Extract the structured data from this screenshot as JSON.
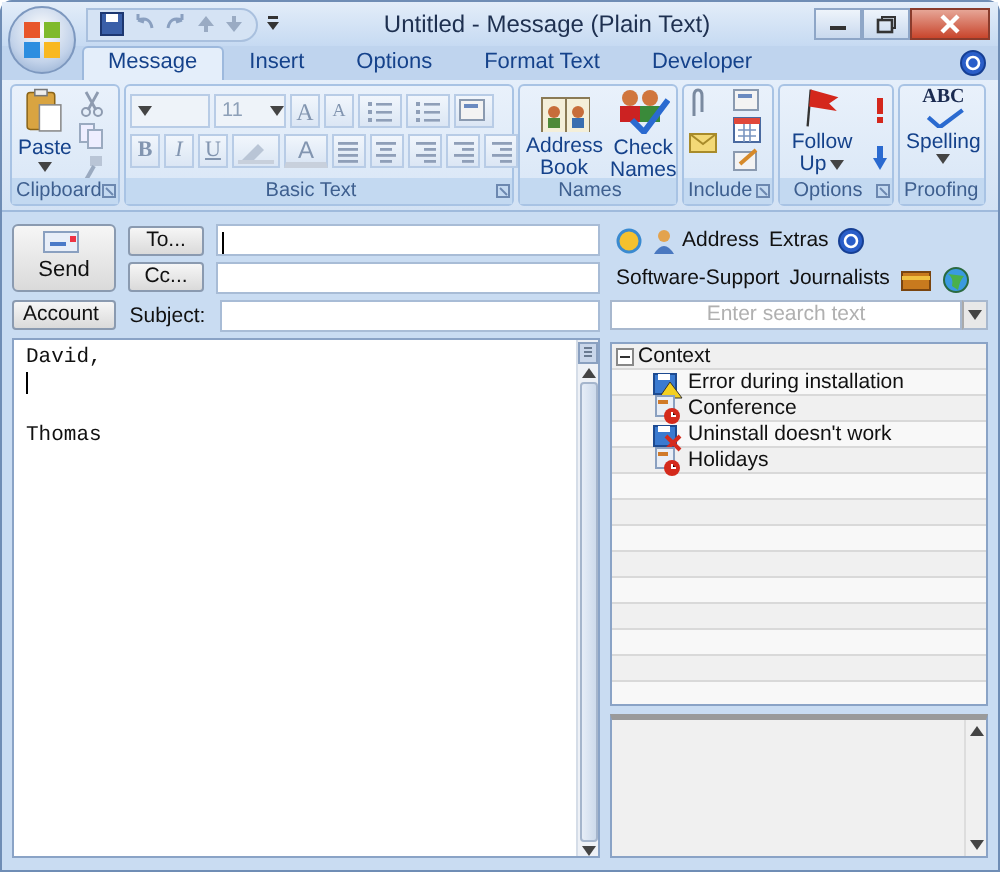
{
  "window": {
    "title": "Untitled - Message (Plain Text)"
  },
  "tabs": [
    {
      "label": "Message",
      "selected": true
    },
    {
      "label": "Insert",
      "selected": false
    },
    {
      "label": "Options",
      "selected": false
    },
    {
      "label": "Format Text",
      "selected": false
    },
    {
      "label": "Developer",
      "selected": false
    }
  ],
  "groups": [
    {
      "kind": "clipboard",
      "label": "Clipboard",
      "buttons": [
        {
          "label": "Paste",
          "dropdown": true
        }
      ]
    },
    {
      "kind": "basic-text",
      "label": "Basic Text",
      "font_size": "11",
      "font_buttons": [
        {
          "label": "A",
          "kind": "grow"
        },
        {
          "label": "A",
          "kind": "shrink"
        }
      ],
      "style_buttons": [
        {
          "label": "B",
          "kind": "bold"
        },
        {
          "label": "I",
          "kind": "italic"
        },
        {
          "label": "U",
          "kind": "underline"
        }
      ],
      "font_color": "A"
    },
    {
      "kind": "names",
      "label": "Names",
      "buttons": [
        {
          "label": "Address Book"
        },
        {
          "label": "Check Names"
        }
      ]
    },
    {
      "kind": "include",
      "label": "Include"
    },
    {
      "kind": "options",
      "label": "Options",
      "buttons": [
        {
          "label": "Follow Up",
          "dropdown": true
        }
      ]
    },
    {
      "kind": "proofing",
      "label": "Proofing",
      "icon_text": "ABC",
      "buttons": [
        {
          "label": "Spelling",
          "dropdown": true
        }
      ]
    }
  ],
  "compose": {
    "send": "Send",
    "to": "To...",
    "cc": "Cc...",
    "account": "Account",
    "subject_label": "Subject:",
    "body": {
      "greeting": "David,",
      "signature": "Thomas"
    }
  },
  "addin": {
    "toolbar": [
      {
        "kind": "icon-button",
        "label": "Address"
      },
      {
        "kind": "text-button",
        "label": "Extras"
      },
      {
        "kind": "text-button",
        "label": "Software-Support"
      },
      {
        "kind": "text-button",
        "label": "Journalists"
      }
    ],
    "search": {
      "placeholder": "Enter search text"
    },
    "tree": {
      "label": "Context",
      "expanded": true,
      "children": [
        {
          "label": "Error during installation",
          "kind": "warning"
        },
        {
          "label": "Conference",
          "kind": "appointment"
        },
        {
          "label": "Uninstall doesn't work",
          "kind": "failed"
        },
        {
          "label": "Holidays",
          "kind": "appointment"
        }
      ]
    }
  }
}
